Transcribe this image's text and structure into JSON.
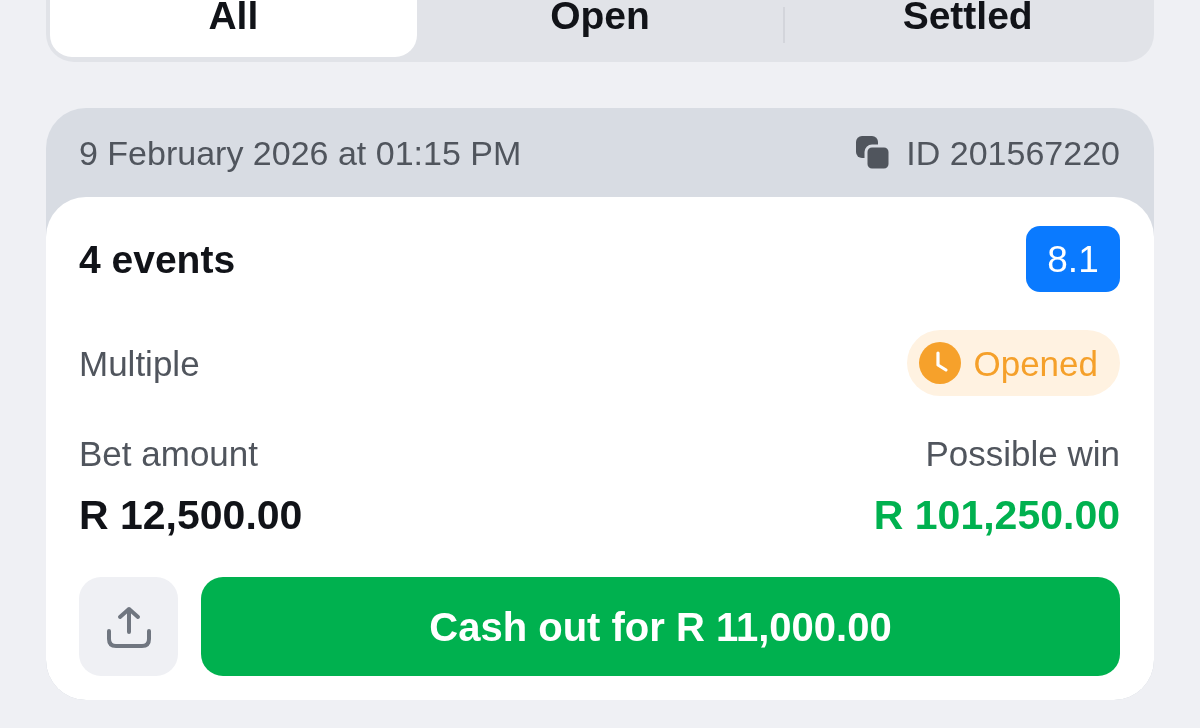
{
  "tabs": [
    {
      "label": "All",
      "selected": true
    },
    {
      "label": "Open",
      "selected": false
    },
    {
      "label": "Settled",
      "selected": false
    }
  ],
  "bet": {
    "date": "9 February 2026 at 01:15 PM",
    "id": "ID 201567220",
    "title": "4 events",
    "odds": "8.1",
    "type": "Multiple",
    "status": {
      "label": "Opened",
      "kind": "open"
    },
    "bet_amount_label": "Bet amount",
    "bet_amount": "R 12,500.00",
    "possible_win_label": "Possible win",
    "possible_win": "R 101,250.00",
    "cash_out_button": "Cash out for R 11,000.00"
  }
}
